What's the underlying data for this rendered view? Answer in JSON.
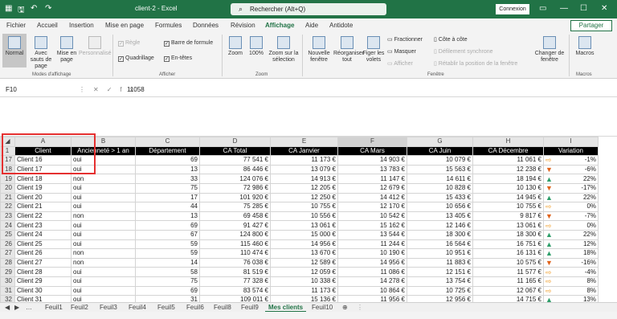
{
  "app": {
    "title": "client-2 - Excel",
    "search_placeholder": "Rechercher (Alt+Q)",
    "signin": "Connexion",
    "share": "Partager",
    "brand_color": "#217346"
  },
  "menu": [
    "Fichier",
    "Accueil",
    "Insertion",
    "Mise en page",
    "Formules",
    "Données",
    "Révision",
    "Affichage",
    "Aide",
    "Antidote"
  ],
  "active_menu": "Affichage",
  "ribbon": {
    "views": [
      "Normal",
      "Avec sauts de page",
      "Mise en page",
      "Personnalisé"
    ],
    "views_group": "Modes d'affichage",
    "show": [
      "Règle",
      "Barre de formule",
      "Quadrillage",
      "En-têtes"
    ],
    "show_group": "Afficher",
    "zoom": [
      "Zoom",
      "100%",
      "Zoom sur la sélection"
    ],
    "zoom_group": "Zoom",
    "window": [
      "Nouvelle fenêtre",
      "Réorganiser tout",
      "Figer les volets",
      "Fractionner",
      "Masquer",
      "Afficher",
      "Côte à côte",
      "Défilement synchrone",
      "Rétablir la position de la fenêtre",
      "Changer de fenêtre"
    ],
    "window_group": "Fenêtre",
    "macros": "Macros",
    "macros_group": "Macros"
  },
  "formula": {
    "cell": "F10",
    "value": "11058"
  },
  "columns": [
    "A",
    "B",
    "C",
    "D",
    "E",
    "F",
    "G",
    "H",
    "I"
  ],
  "headers": [
    "Client",
    "Ancienneté > 1 an",
    "Département",
    "CA Total",
    "CA Janvier",
    "CA Mars",
    "CA Juin",
    "CA Décembre",
    "Variation"
  ],
  "rows": [
    {
      "n": "17",
      "client": "Client 16",
      "anc": "oui",
      "dep": "69",
      "total": "77 541 €",
      "jan": "11 173 €",
      "mar": "14 903 €",
      "jun": "10 079 €",
      "dec": "11 061 €",
      "trend": "flat",
      "var": "-1%"
    },
    {
      "n": "18",
      "client": "Client 17",
      "anc": "oui",
      "dep": "13",
      "total": "86 446 €",
      "jan": "13 079 €",
      "mar": "13 783 €",
      "jun": "15 563 €",
      "dec": "12 238 €",
      "trend": "down",
      "var": "-6%"
    },
    {
      "n": "19",
      "client": "Client 18",
      "anc": "non",
      "dep": "33",
      "total": "124 076 €",
      "jan": "14 913 €",
      "mar": "11 147 €",
      "jun": "14 611 €",
      "dec": "18 194 €",
      "trend": "up",
      "var": "22%"
    },
    {
      "n": "20",
      "client": "Client 19",
      "anc": "oui",
      "dep": "75",
      "total": "72 986 €",
      "jan": "12 205 €",
      "mar": "12 679 €",
      "jun": "10 828 €",
      "dec": "10 130 €",
      "trend": "down",
      "var": "-17%"
    },
    {
      "n": "21",
      "client": "Client 20",
      "anc": "oui",
      "dep": "17",
      "total": "101 920 €",
      "jan": "12 250 €",
      "mar": "14 412 €",
      "jun": "15 433 €",
      "dec": "14 945 €",
      "trend": "up",
      "var": "22%"
    },
    {
      "n": "22",
      "client": "Client 21",
      "anc": "oui",
      "dep": "44",
      "total": "75 285 €",
      "jan": "10 755 €",
      "mar": "12 170 €",
      "jun": "10 656 €",
      "dec": "10 755 €",
      "trend": "flat",
      "var": "0%"
    },
    {
      "n": "23",
      "client": "Client 22",
      "anc": "non",
      "dep": "13",
      "total": "69 458 €",
      "jan": "10 556 €",
      "mar": "10 542 €",
      "jun": "13 405 €",
      "dec": "9 817 €",
      "trend": "down",
      "var": "-7%"
    },
    {
      "n": "24",
      "client": "Client 23",
      "anc": "oui",
      "dep": "69",
      "total": "91 427 €",
      "jan": "13 061 €",
      "mar": "15 162 €",
      "jun": "12 146 €",
      "dec": "13 061 €",
      "trend": "flat",
      "var": "0%"
    },
    {
      "n": "25",
      "client": "Client 24",
      "anc": "oui",
      "dep": "67",
      "total": "124 800 €",
      "jan": "15 000 €",
      "mar": "13 544 €",
      "jun": "18 300 €",
      "dec": "18 300 €",
      "trend": "up",
      "var": "22%"
    },
    {
      "n": "26",
      "client": "Client 25",
      "anc": "oui",
      "dep": "59",
      "total": "115 460 €",
      "jan": "14 956 €",
      "mar": "11 244 €",
      "jun": "16 564 €",
      "dec": "16 751 €",
      "trend": "up",
      "var": "12%"
    },
    {
      "n": "27",
      "client": "Client 26",
      "anc": "non",
      "dep": "59",
      "total": "110 474 €",
      "jan": "13 670 €",
      "mar": "10 190 €",
      "jun": "10 951 €",
      "dec": "16 131 €",
      "trend": "up",
      "var": "18%"
    },
    {
      "n": "28",
      "client": "Client 27",
      "anc": "non",
      "dep": "14",
      "total": "76 038 €",
      "jan": "12 589 €",
      "mar": "14 956 €",
      "jun": "11 883 €",
      "dec": "10 575 €",
      "trend": "down",
      "var": "-16%"
    },
    {
      "n": "29",
      "client": "Client 28",
      "anc": "oui",
      "dep": "58",
      "total": "81 519 €",
      "jan": "12 059 €",
      "mar": "11 086 €",
      "jun": "12 151 €",
      "dec": "11 577 €",
      "trend": "flat",
      "var": "-4%"
    },
    {
      "n": "30",
      "client": "Client 29",
      "anc": "oui",
      "dep": "75",
      "total": "77 328 €",
      "jan": "10 338 €",
      "mar": "14 278 €",
      "jun": "13 754 €",
      "dec": "11 165 €",
      "trend": "flat",
      "var": "8%"
    },
    {
      "n": "31",
      "client": "Client 30",
      "anc": "oui",
      "dep": "69",
      "total": "83 574 €",
      "jan": "11 173 €",
      "mar": "10 864 €",
      "jun": "10 725 €",
      "dec": "12 067 €",
      "trend": "flat",
      "var": "8%"
    },
    {
      "n": "32",
      "client": "Client 31",
      "anc": "oui",
      "dep": "31",
      "total": "109 011 €",
      "jan": "15 136 €",
      "mar": "11 956 €",
      "jun": "12 956 €",
      "dec": "14 715 €",
      "trend": "up",
      "var": "13%"
    }
  ],
  "sheets": [
    "Feuil1",
    "Feuil2",
    "Feuil3",
    "Feuil4",
    "Feuil5",
    "Feuil6",
    "Feuil8",
    "Feuil9",
    "Mes clients",
    "Feuil10"
  ],
  "active_sheet": "Mes clients"
}
